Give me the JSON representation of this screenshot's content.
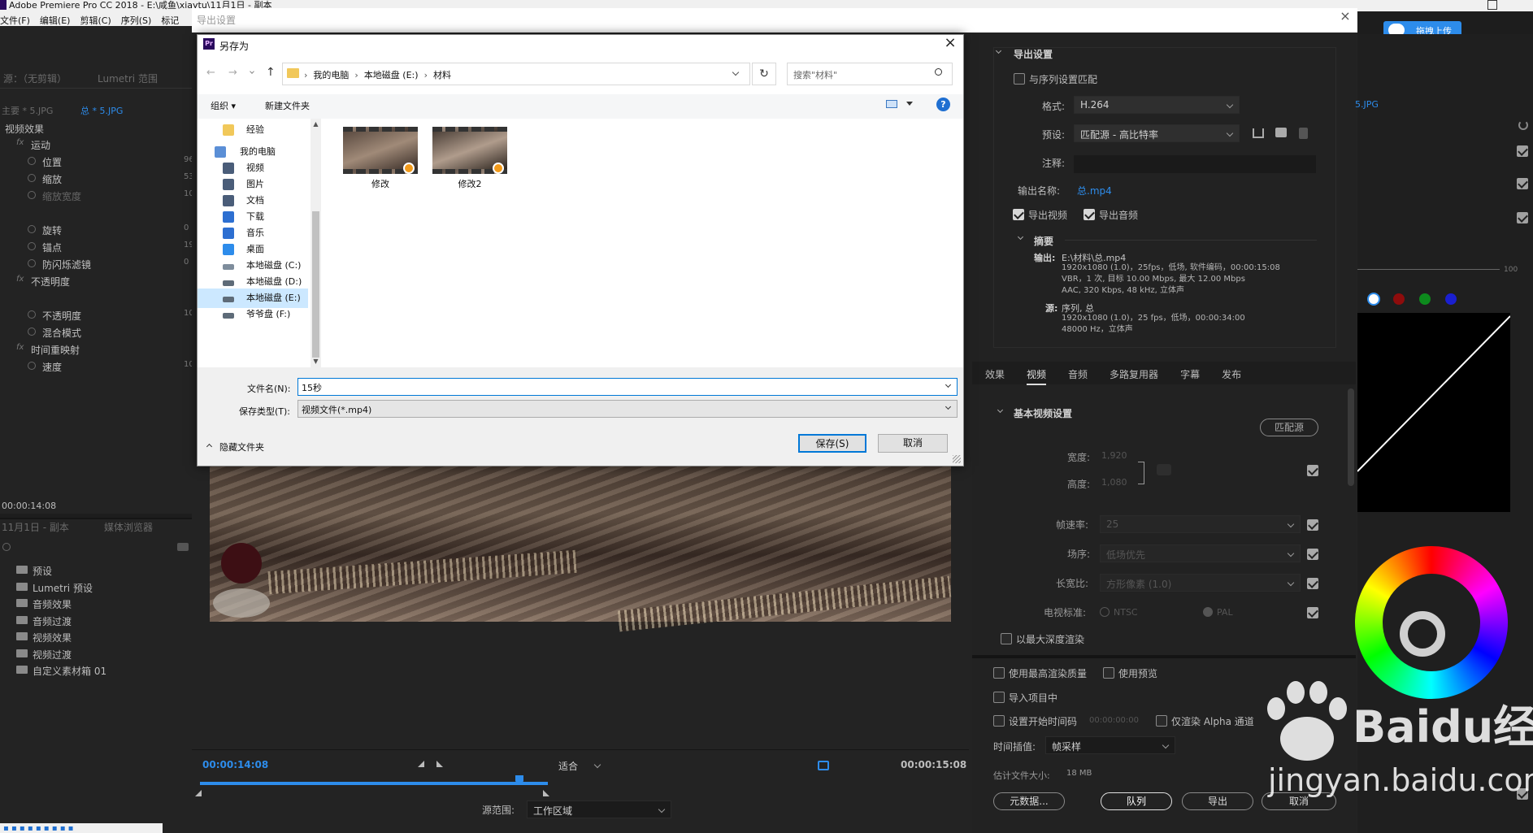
{
  "app": {
    "title": "Adobe Premiere Pro CC 2018 - E:\\咸鱼\\xiaytu\\11月1日 - 副本",
    "menu": [
      "文件(F)",
      "编辑(E)",
      "剪辑(C)",
      "序列(S)",
      "标记"
    ]
  },
  "left_panel": {
    "source_tab": "源：（无剪辑）",
    "lumetri_tab": "Lumetri 范围",
    "master_label": "主要 * 5.JPG",
    "clip_label": "总 * 5.JPG",
    "video_effects": "视频效果",
    "props": [
      {
        "label": "运动",
        "indent": 1,
        "fx": true,
        "value": ""
      },
      {
        "label": "位置",
        "indent": 2,
        "fx": false,
        "value": "96"
      },
      {
        "label": "缩放",
        "indent": 2,
        "fx": false,
        "value": "53"
      },
      {
        "label": "缩放宽度",
        "indent": 2,
        "fx": false,
        "value": "10"
      },
      {
        "label": "",
        "indent": 2,
        "fx": false,
        "value": ""
      },
      {
        "label": "旋转",
        "indent": 2,
        "fx": false,
        "value": "0"
      },
      {
        "label": "锚点",
        "indent": 2,
        "fx": false,
        "value": "19"
      },
      {
        "label": "防闪烁滤镜",
        "indent": 2,
        "fx": false,
        "value": "0"
      },
      {
        "label": "不透明度",
        "indent": 1,
        "fx": true,
        "value": ""
      },
      {
        "label": "",
        "indent": 2,
        "fx": false,
        "value": ""
      },
      {
        "label": "不透明度",
        "indent": 2,
        "fx": false,
        "value": "10"
      },
      {
        "label": "混合模式",
        "indent": 2,
        "fx": false,
        "value": ""
      },
      {
        "label": "时间重映射",
        "indent": 1,
        "fx": true,
        "value": ""
      },
      {
        "label": "速度",
        "indent": 2,
        "fx": false,
        "value": "10"
      }
    ],
    "timecode": "00:00:14:08",
    "project_tab": "11月1日 - 副本",
    "media_tab": "媒体浏览器",
    "folders": [
      "预设",
      "Lumetri 预设",
      "音频效果",
      "音频过渡",
      "视频效果",
      "视频过渡",
      "自定义素材箱 01"
    ]
  },
  "export_window": {
    "title": "导出设置",
    "upload_label": "拖拽上传",
    "source_range_label": "源范围:",
    "source_range_value": "工作区域",
    "fit_label": "适合",
    "tc_start": "00:00:14:08",
    "tc_end": "00:00:15:08",
    "settings": {
      "section": "导出设置",
      "match_seq": "与序列设置匹配",
      "format_label": "格式:",
      "format_value": "H.264",
      "preset_label": "预设:",
      "preset_value": "匹配源 - 高比特率",
      "comment_label": "注释:",
      "output_name_label": "输出名称:",
      "output_name_value": "总.mp4",
      "export_video": "导出视频",
      "export_audio": "导出音频",
      "summary": "摘要",
      "output_label": "输出:",
      "output_lines": [
        "E:\\材料\\总.mp4",
        "1920x1080 (1.0)，25fps，低场, 软件编码，00:00:15:08",
        "VBR，1 次, 目标 10.00 Mbps, 最大 12.00 Mbps",
        "AAC, 320 Kbps, 48  kHz, 立体声"
      ],
      "source_label": "源:",
      "source_lines": [
        "序列, 总",
        "1920x1080 (1.0)，25 fps，低场，00:00:34:00",
        "48000 Hz，立体声"
      ],
      "tabs": [
        "效果",
        "视频",
        "音频",
        "多路复用器",
        "字幕",
        "发布"
      ],
      "active_tab": "视频",
      "basic_video": "基本视频设置",
      "match_source_btn": "匹配源",
      "width_label": "宽度:",
      "width_value": "1,920",
      "height_label": "高度:",
      "height_value": "1,080",
      "fps_label": "帧速率:",
      "fps_value": "25",
      "field_label": "场序:",
      "field_value": "低场优先",
      "aspect_label": "长宽比:",
      "aspect_value": "方形像素 (1.0)",
      "tv_label": "电视标准:",
      "ntsc": "NTSC",
      "pal": "PAL",
      "max_depth": "以最大深度渲染",
      "max_quality": "使用最高渲染质量",
      "use_previews": "使用预览",
      "import_project": "导入项目中",
      "set_start_tc": "设置开始时间码",
      "start_tc_value": "00:00:00:00",
      "only_alpha": "仅渲染 Alpha 通道",
      "interp_label": "时间插值:",
      "interp_value": "帧采样",
      "filesize_label": "估计文件大小:",
      "filesize_value": "18 MB",
      "metadata_btn": "元数据...",
      "queue_btn": "队列",
      "export_btn": "导出",
      "cancel_btn": "取消"
    }
  },
  "right_edge": {
    "label_jpg": "5.JPG",
    "scale_100": "100"
  },
  "save_dialog": {
    "app_icon": "Pr",
    "title": "另存为",
    "breadcrumb": [
      "我的电脑",
      "本地磁盘 (E:)",
      "材料"
    ],
    "search_placeholder": "搜索\"材料\"",
    "organize": "组织",
    "new_folder": "新建文件夹",
    "tree": [
      {
        "label": "经验",
        "icon": "folder-icon",
        "level": 2
      },
      {
        "label": "我的电脑",
        "icon": "computer-icon",
        "level": 1
      },
      {
        "label": "视频",
        "icon": "video-folder-icon",
        "level": 2
      },
      {
        "label": "图片",
        "icon": "pictures-folder-icon",
        "level": 2
      },
      {
        "label": "文档",
        "icon": "documents-folder-icon",
        "level": 2
      },
      {
        "label": "下载",
        "icon": "download-icon",
        "level": 2
      },
      {
        "label": "音乐",
        "icon": "music-icon",
        "level": 2
      },
      {
        "label": "桌面",
        "icon": "desktop-icon",
        "level": 2
      },
      {
        "label": "本地磁盘 (C:)",
        "icon": "drive-c-icon",
        "level": 2
      },
      {
        "label": "本地磁盘 (D:)",
        "icon": "drive-icon",
        "level": 2
      },
      {
        "label": "本地磁盘 (E:)",
        "icon": "drive-icon",
        "level": 2
      },
      {
        "label": "爷爷盘 (F:)",
        "icon": "drive-icon",
        "level": 2
      }
    ],
    "files": [
      "修改",
      "修改2"
    ],
    "filename_label": "文件名(N):",
    "filename_value": "15秒",
    "filetype_label": "保存类型(T):",
    "filetype_value": "视频文件(*.mp4)",
    "hide_folders": "隐藏文件夹",
    "save_btn": "保存(S)",
    "cancel_btn": "取消"
  },
  "watermark": {
    "brand": "Baidu经验",
    "url": "jingyan.baidu.com"
  },
  "colors": {
    "accent_blue": "#2d8ceb",
    "dialog_select": "#cce8ff",
    "primary_button_border": "#0078d7"
  }
}
